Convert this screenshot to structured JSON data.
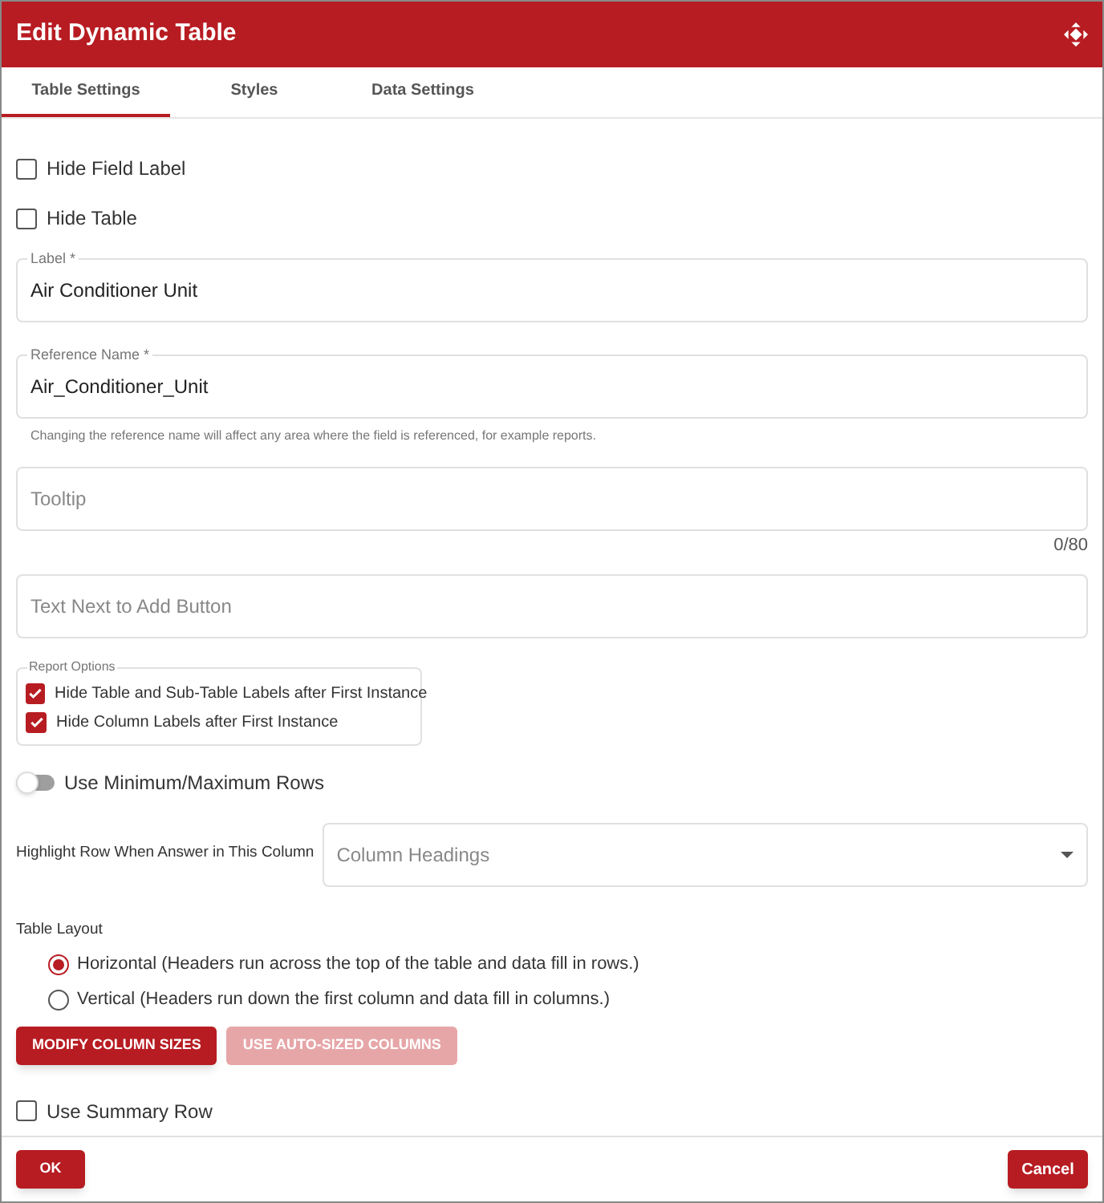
{
  "window": {
    "title": "Edit Dynamic Table"
  },
  "tabs": [
    {
      "label": "Table Settings",
      "selected": true
    },
    {
      "label": "Styles",
      "selected": false
    },
    {
      "label": "Data Settings",
      "selected": false
    }
  ],
  "top_checkboxes": [
    {
      "label": "Hide Field Label",
      "checked": false
    },
    {
      "label": "Hide Table",
      "checked": false
    }
  ],
  "label_field": {
    "label": "Label *",
    "value": "Air Conditioner Unit"
  },
  "reference_field": {
    "label": "Reference Name *",
    "value": "Air_Conditioner_Unit",
    "helper": "Changing the reference name will affect any area where the field is referenced, for example reports."
  },
  "tooltip_field": {
    "placeholder": "Tooltip",
    "counter": "0/80"
  },
  "add_button_text_field": {
    "placeholder": "Text Next to Add Button"
  },
  "report_options": {
    "title": "Report Options",
    "items": [
      {
        "label": "Hide Table and Sub-Table Labels after First Instance",
        "checked": true
      },
      {
        "label": "Hide Column Labels after First Instance",
        "checked": true
      }
    ]
  },
  "min_max_switch": {
    "label": "Use Minimum/Maximum Rows",
    "on": false
  },
  "highlight_row": {
    "label": "Highlight Row When Answer in This Column",
    "placeholder": "Column Headings"
  },
  "table_layout": {
    "title": "Table Layout",
    "options": [
      {
        "label": "Horizontal (Headers run across the top of the table and data fill in rows.)",
        "selected": true
      },
      {
        "label": "Vertical (Headers run down the first column and data fill in columns.)",
        "selected": false
      }
    ]
  },
  "column_buttons": [
    {
      "label": "MODIFY COLUMN SIZES",
      "disabled": false
    },
    {
      "label": "USE AUTO-SIZED COLUMNS",
      "disabled": true
    }
  ],
  "summary_checkbox": {
    "label": "Use Summary Row",
    "checked": false
  },
  "footer": {
    "ok": "OK",
    "cancel": "Cancel"
  }
}
